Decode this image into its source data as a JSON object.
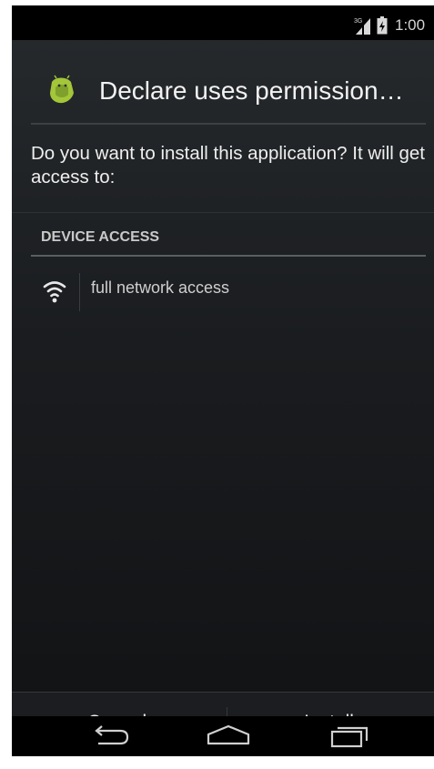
{
  "status_bar": {
    "network": "3G",
    "time": "1:00",
    "signal_icon": "signal-3g-icon",
    "battery_icon": "battery-icon"
  },
  "dialog": {
    "app_icon": "android-app-icon",
    "title": "Declare uses permission…",
    "question": "Do you want to install this application? It will get access to:",
    "section_header": "DEVICE ACCESS",
    "permissions": [
      {
        "icon": "wifi-icon",
        "label": "full network access"
      }
    ]
  },
  "buttons": {
    "cancel_label": "Cancel",
    "install_label": "Install"
  },
  "navigation": {
    "back_icon": "back-icon",
    "home_icon": "home-icon",
    "recents_icon": "recent-apps-icon"
  },
  "colors": {
    "app_icon_green": "#a4c639",
    "text_primary": "#f2f2f2",
    "background": "#1a1c1f"
  }
}
